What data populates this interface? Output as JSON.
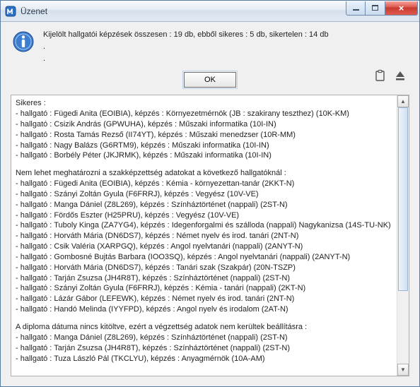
{
  "window": {
    "title": "Üzenet"
  },
  "summary": {
    "line1": "Kijelölt hallgatói képzések összesen : 19 db, ebből sikeres : 5 db, sikertelen : 14 db",
    "dot1": ".",
    "dot2": "."
  },
  "buttons": {
    "ok": "OK"
  },
  "sections": {
    "success_heading": "Sikeres :",
    "success_items": [
      "- hallgató : Fügedi Anita (EOIBIA), képzés : Környezetmérnök (JB : szakirany teszthez) (10K-KM)",
      "- hallgató : Csizik András (GPWUHA), képzés : Műszaki informatika (10I-IN)",
      "- hallgató : Rosta Tamás Rezső (II74YT), képzés : Műszaki menedzser (10R-MM)",
      "- hallgató : Nagy Balázs (G6RTM9), képzés : Műszaki informatika (10I-IN)",
      "- hallgató : Borbély Péter (JKJRMK), képzés : Műszaki informatika (10I-IN)"
    ],
    "cannot_heading": "Nem lehet meghatározni a szakképzettség adatokat a következő hallgatóknál :",
    "cannot_items": [
      "- hallgató : Fügedi Anita (EOIBIA), képzés : Kémia - környezettan-tanár (2KKT-N)",
      "- hallgató : Szányi Zoltán Gyula (F6FRRJ), képzés : Vegyész (10V-VE)",
      "- hallgató : Manga Dániel (Z8L269), képzés : Színháztörténet (nappali) (2ST-N)",
      "- hallgató : Fördős Eszter (H25PRU), képzés : Vegyész (10V-VE)",
      "- hallgató : Tuboly Kinga (ZA7YG4), képzés : Idegenforgalmi és szálloda (nappali) Nagykanizsa (14S-TU-NK)",
      "- hallgató : Horváth Mária (DN6DS7), képzés : Német nyelv és irod. tanári  (2NT-N)",
      "- hallgató : Csik Valéria (XARPGQ), képzés : Angol nyelvtanári (nappali) (2ANYT-N)",
      "- hallgató : Gombosné Bujtás Barbara (IOO3SQ), képzés : Angol nyelvtanári (nappali) (2ANYT-N)",
      "- hallgató : Horváth Mária (DN6DS7), képzés : Tanári szak (Szakpár) (20N-TSZP)",
      "- hallgató : Tarján Zsuzsa (JH4R8T), képzés : Színháztörténet (nappali) (2ST-N)",
      "- hallgató : Szányi Zoltán Gyula (F6FRRJ), képzés : Kémia - tanári (nappali) (2KT-N)",
      "- hallgató : Lázár Gábor (LEFEWK), képzés : Német nyelv és irod. tanári  (2NT-N)",
      "- hallgató : Handó Melinda (IYYFPD), képzés : Angol nyelv és irodalom  (2AT-N)"
    ],
    "diploma_heading": "A diploma dátuma nincs kitöltve, ezért a végzettség adatok nem kerültek beállításra :",
    "diploma_items": [
      "- hallgató : Manga Dániel (Z8L269), képzés : Színháztörténet (nappali) (2ST-N)",
      "- hallgató : Tarján Zsuzsa (JH4R8T), képzés : Színháztörténet (nappali) (2ST-N)",
      "- hallgató : Tuza László Pál (TKCLYU), képzés : Anyagmérnök (10A-AM)"
    ]
  }
}
